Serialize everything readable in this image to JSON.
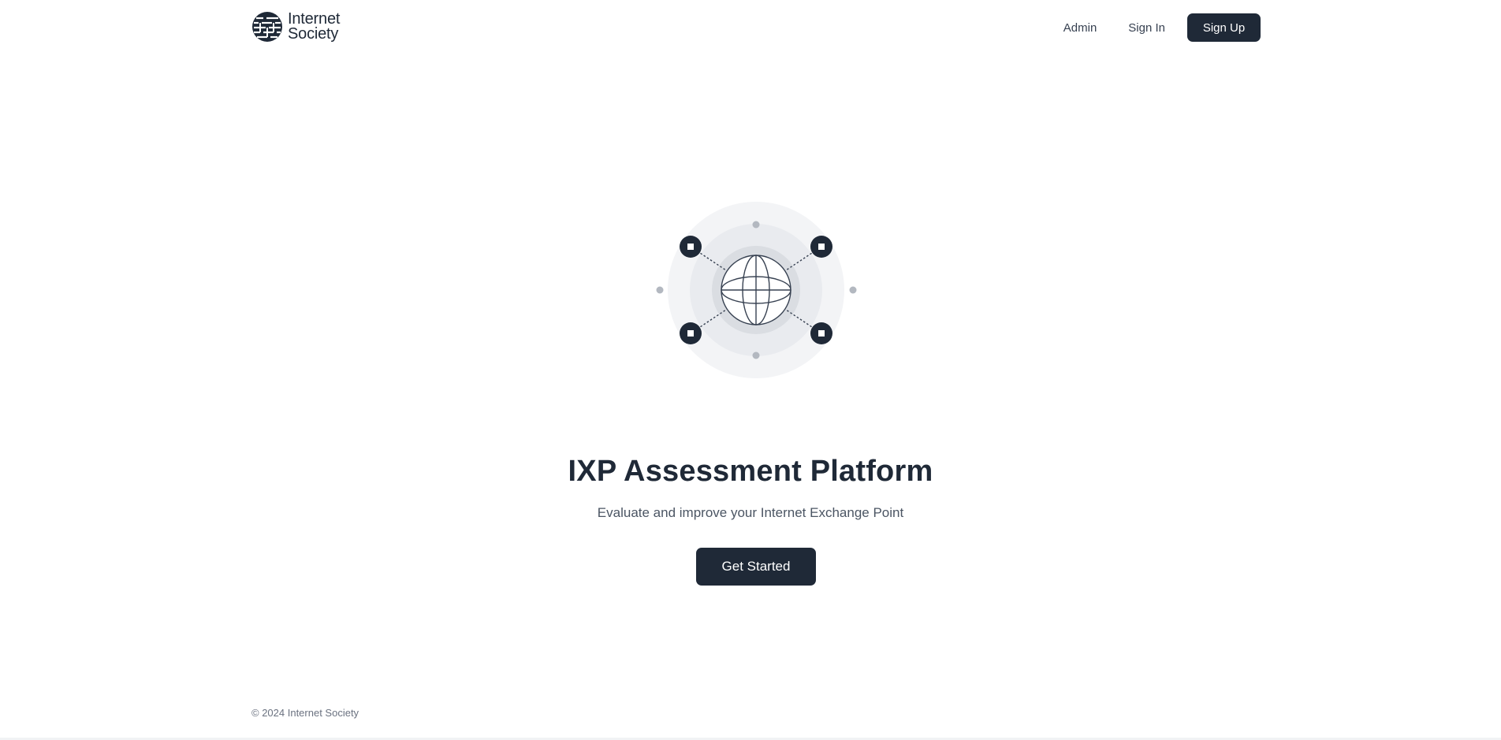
{
  "header": {
    "logo": {
      "line1": "Internet",
      "line2": "Society",
      "icon": "internet-society-globe-logo"
    },
    "nav": {
      "admin_label": "Admin",
      "signin_label": "Sign In",
      "signup_label": "Sign Up"
    }
  },
  "hero": {
    "illustration_icon": "globe-network-icon",
    "title": "IXP Assessment Platform",
    "subtitle": "Evaluate and improve your Internet Exchange Point",
    "cta_label": "Get Started"
  },
  "footer": {
    "copyright": "© 2024 Internet Society"
  },
  "colors": {
    "primary": "#1f2937",
    "muted_text": "#6b7280",
    "ring_outer": "#f3f4f6",
    "ring_mid": "#e5e7eb",
    "ring_inner": "#d1d5db"
  }
}
